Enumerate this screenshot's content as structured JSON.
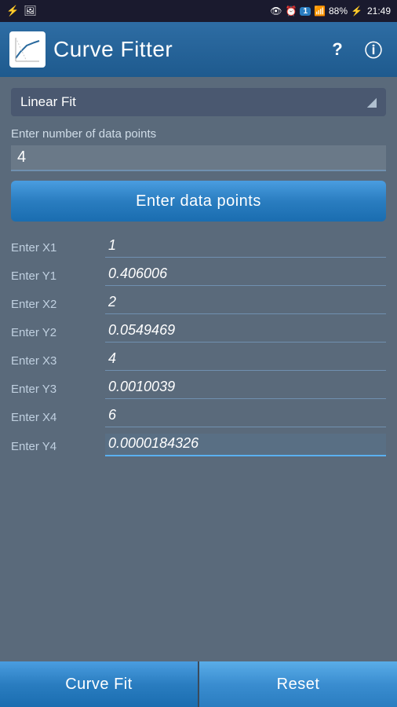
{
  "statusBar": {
    "time": "21:49",
    "battery": "88%",
    "batteryIcon": "⚡"
  },
  "header": {
    "title": "Curve Fitter",
    "helpLabel": "?",
    "infoLabel": "ⓘ"
  },
  "fitSelector": {
    "label": "Linear Fit",
    "arrowLabel": "◢"
  },
  "dataSection": {
    "numPointsLabel": "Enter number of data points",
    "numPointsValue": "4",
    "enterDataBtnLabel": "Enter data points"
  },
  "fields": [
    {
      "label": "Enter X1",
      "value": "1",
      "highlighted": false
    },
    {
      "label": "Enter Y1",
      "value": "0.406006",
      "highlighted": false
    },
    {
      "label": "Enter X2",
      "value": "2",
      "highlighted": false
    },
    {
      "label": "Enter Y2",
      "value": "0.0549469",
      "highlighted": false
    },
    {
      "label": "Enter X3",
      "value": "4",
      "highlighted": false
    },
    {
      "label": "Enter Y3",
      "value": "0.0010039",
      "highlighted": false
    },
    {
      "label": "Enter X4",
      "value": "6",
      "highlighted": false
    },
    {
      "label": "Enter Y4",
      "value": "0.0000184326",
      "highlighted": true
    }
  ],
  "bottomBar": {
    "curveFitLabel": "Curve Fit",
    "resetLabel": "Reset"
  }
}
